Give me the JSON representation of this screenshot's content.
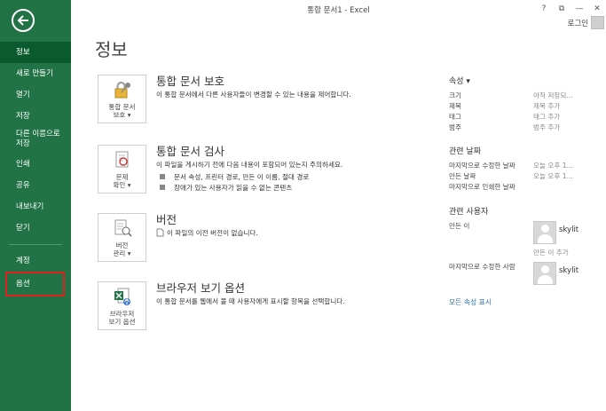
{
  "window": {
    "title": "통합 문서1 - Excel",
    "help": "?",
    "min": "—",
    "close": "✕",
    "restore": "⧉"
  },
  "account": {
    "login": "로그인"
  },
  "sidebar": {
    "items": [
      {
        "label": "정보"
      },
      {
        "label": "새로 만들기"
      },
      {
        "label": "열기"
      },
      {
        "label": "저장"
      },
      {
        "label": "다른 이름으로\n저장"
      },
      {
        "label": "인쇄"
      },
      {
        "label": "공유"
      },
      {
        "label": "내보내기"
      },
      {
        "label": "닫기"
      },
      {
        "label": "계정"
      },
      {
        "label": "옵션"
      }
    ]
  },
  "page": {
    "title": "정보"
  },
  "sections": {
    "protect": {
      "icon_label": "통합 문서\n보호 ▾",
      "title": "통합 문서 보호",
      "desc": "이 통합 문서에서 다른 사용자들이 변경할 수 있는 내용을 제어합니다."
    },
    "inspect": {
      "icon_label": "문제\n확인 ▾",
      "title": "통합 문서 검사",
      "desc": "이 파일을 게시하기 전에 다음 내용이 포함되어 있는지 주의하세요.",
      "bullets": [
        "문서 속성, 프린터 경로, 만든 이 이름, 절대 경로",
        "장애가 있는 사용자가 읽을 수 없는 콘텐츠"
      ]
    },
    "versions": {
      "icon_label": "버전\n관리 ▾",
      "title": "버전",
      "desc": "이 파일의 이전 버전이 없습니다."
    },
    "browser": {
      "icon_label": "브라우저\n보기 옵션",
      "title": "브라우저 보기 옵션",
      "desc": "이 통합 문서를 웹에서 볼 때 사용자에게 표시할 항목을 선택합니다."
    }
  },
  "properties": {
    "heading": "속성 ▾",
    "rows": [
      {
        "k": "크기",
        "v": "아직 저장되..."
      },
      {
        "k": "제목",
        "v": "제목 추가"
      },
      {
        "k": "태그",
        "v": "태그 추가"
      },
      {
        "k": "범주",
        "v": "범주 추가"
      }
    ],
    "dates_heading": "관련 날짜",
    "dates": [
      {
        "k": "마지막으로 수정한 날짜",
        "v": "오늘 오후 1..."
      },
      {
        "k": "만든 날짜",
        "v": "오늘 오후 1..."
      },
      {
        "k": "마지막으로 인쇄한 날짜",
        "v": ""
      }
    ],
    "people_heading": "관련 사용자",
    "author_label": "만든 이",
    "author_name": "skylit",
    "add_author": "만든 이 추가",
    "modified_by_label": "마지막으로 수정한 사람",
    "modified_by_name": "skylit",
    "show_all": "모든 속성 표시"
  }
}
